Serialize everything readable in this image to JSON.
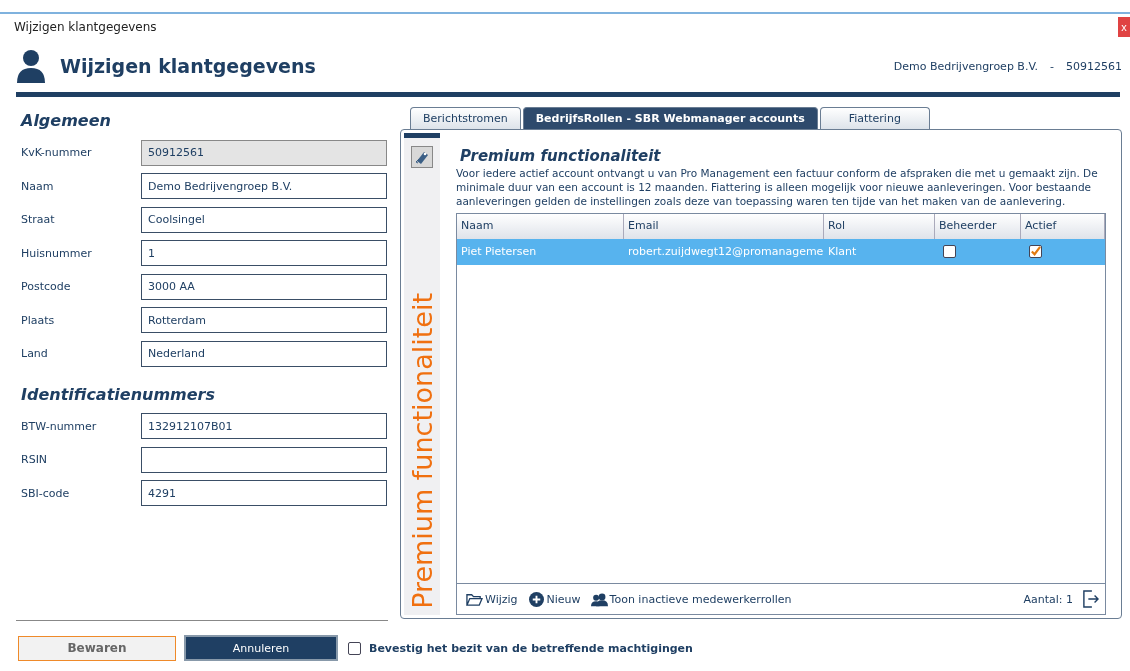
{
  "window": {
    "title": "Wijzigen klantgegevens",
    "close": "x"
  },
  "header": {
    "title": "Wijzigen klantgegevens",
    "company": "Demo Bedrijvengroep B.V.",
    "separator": "-",
    "number": "50912561"
  },
  "sections": [
    {
      "title": "Algemeen",
      "fields": [
        {
          "label": "KvK-nummer",
          "value": "50912561",
          "disabled": true
        },
        {
          "label": "Naam",
          "value": "Demo Bedrijvengroep B.V.",
          "disabled": false
        },
        {
          "label": "Straat",
          "value": "Coolsingel",
          "disabled": false
        },
        {
          "label": "Huisnummer",
          "value": "1",
          "disabled": false
        },
        {
          "label": "Postcode",
          "value": "3000 AA",
          "disabled": false
        },
        {
          "label": "Plaats",
          "value": "Rotterdam",
          "disabled": false
        },
        {
          "label": "Land",
          "value": "Nederland",
          "disabled": false
        }
      ]
    },
    {
      "title": "Identificatienummers",
      "fields": [
        {
          "label": "BTW-nummer",
          "value": "132912107B01",
          "disabled": false
        },
        {
          "label": "RSIN",
          "disabled": false
        },
        {
          "label": "SBI-code",
          "value": "4291",
          "disabled": false
        }
      ]
    }
  ],
  "tabs": [
    {
      "label": "Berichtstromen",
      "selected": false
    },
    {
      "label": "BedrijfsRollen - SBR Webmanager accounts",
      "selected": true
    },
    {
      "label": "Fiattering",
      "selected": false
    }
  ],
  "panel": {
    "side_label": "Premium functionaliteit",
    "title": "Premium functionaliteit",
    "description": "Voor iedere actief account ontvangt u van Pro Management een factuur conform de afspraken die met u gemaakt zijn. De minimale duur van een account is 12 maanden. Fiattering is alleen mogelijk voor nieuwe aanleveringen. Voor bestaande aanleveringen gelden de instellingen zoals deze van toepassing waren ten tijde van het maken van de aanlevering."
  },
  "table": {
    "columns": [
      "Naam",
      "Email",
      "Rol",
      "Beheerder",
      "Actief"
    ],
    "rows": [
      {
        "naam": "Piet Pietersen",
        "email": "robert.zuijdwegt12@promanageme",
        "rol": "Klant",
        "beheerder": false,
        "actief": true,
        "selected": true
      }
    ]
  },
  "toolbar": {
    "buttons": [
      {
        "kind": "folder",
        "label": "Wijzig"
      },
      {
        "kind": "plus",
        "label": "Nieuw"
      },
      {
        "kind": "people",
        "label": "Toon inactieve medewerkerrollen"
      }
    ],
    "count": "Aantal: 1"
  },
  "footer": {
    "save": "Bewaren",
    "cancel": "Annuleren",
    "confirm": {
      "label": "Bevestig het bezit van de betreffende machtigingen",
      "checked": false
    }
  }
}
